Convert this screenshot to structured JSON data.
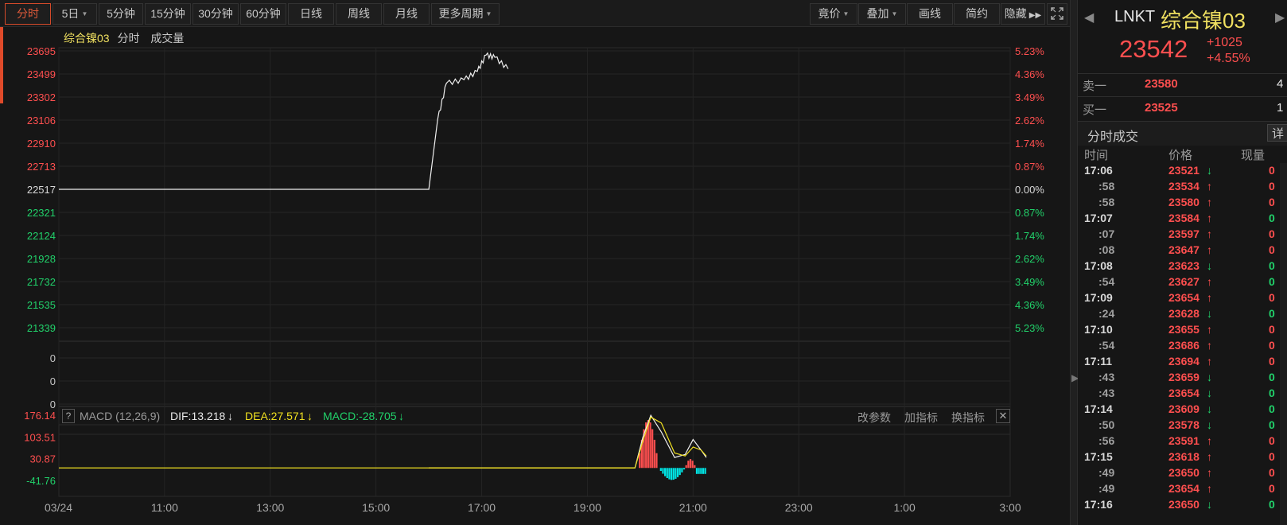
{
  "toolbar": {
    "periods": [
      {
        "label": "分时",
        "active": true
      },
      {
        "label": "5日",
        "dropdown": true
      },
      {
        "label": "5分钟"
      },
      {
        "label": "15分钟"
      },
      {
        "label": "30分钟"
      },
      {
        "label": "60分钟"
      },
      {
        "label": "日线"
      },
      {
        "label": "周线"
      },
      {
        "label": "月线"
      },
      {
        "label": "更多周期",
        "dropdown": true
      }
    ],
    "tools": [
      {
        "label": "竟价",
        "dropdown": true
      },
      {
        "label": "叠加",
        "dropdown": true
      },
      {
        "label": "画线"
      },
      {
        "label": "简约"
      },
      {
        "label": "隐藏"
      }
    ],
    "fullscreen_icon": "fullscreen-icon"
  },
  "legend": {
    "name": "综合镍03",
    "mode": "分时",
    "volume": "成交量"
  },
  "price_axis": {
    "left_labels": [
      "23695",
      "23499",
      "23302",
      "23106",
      "22910",
      "22713",
      "22517",
      "22321",
      "22124",
      "21928",
      "21732",
      "21535",
      "21339"
    ],
    "right_labels": [
      "5.23%",
      "4.36%",
      "3.49%",
      "2.62%",
      "1.74%",
      "0.87%",
      "0.00%",
      "0.87%",
      "1.74%",
      "2.62%",
      "3.49%",
      "4.36%",
      "5.23%"
    ]
  },
  "volume_axis": {
    "labels": [
      "0",
      "0",
      "0"
    ]
  },
  "macd": {
    "help": "?",
    "name": "MACD (12,26,9)",
    "dif": "DIF:13.218",
    "dea": "DEA:27.571",
    "macd_value": "MACD:-28.705",
    "actions": [
      "改参数",
      "加指标",
      "换指标"
    ],
    "axis_labels": [
      "176.14",
      "103.51",
      "30.87",
      "-41.76"
    ]
  },
  "time_axis": [
    "03/24",
    "11:00",
    "13:00",
    "15:00",
    "17:00",
    "19:00",
    "21:00",
    "23:00",
    "1:00",
    "3:00"
  ],
  "colors": {
    "up": "#ff4f4f",
    "down": "#21d16a",
    "accent": "#e05a3a",
    "yellow": "#f0e020",
    "cyan": "#00e5e5"
  },
  "chart_data": [
    {
      "type": "line",
      "series": [],
      "x": [
        "03/24",
        "11:00",
        "13:00",
        "15:00",
        "16:00",
        "16:10",
        "16:20",
        "16:40",
        "16:55",
        "17:05",
        "17:15",
        "17:30"
      ],
      "values": [
        22517,
        22517,
        22517,
        22517,
        22517,
        23110,
        23420,
        23450,
        23520,
        23660,
        23640,
        23542
      ],
      "ylim": [
        21339,
        23695
      ],
      "base": 22517
    },
    {
      "type": "line",
      "series": [
        {
          "x": [
            0,
            3.9,
            4.05,
            4.2,
            4.4,
            4.65,
            4.85,
            5.0,
            5.15,
            5.25
          ],
          "values": [
            0,
            0,
            103,
            176,
            120,
            35,
            45,
            95,
            60,
            35
          ]
        },
        {
          "x": [
            0,
            3.9,
            4.05,
            4.2,
            4.4,
            4.65,
            4.85,
            5.0,
            5.15,
            5.25
          ],
          "values": [
            0,
            0,
            90,
            170,
            150,
            50,
            40,
            70,
            60,
            40
          ]
        }
      ],
      "ylim": [
        -41.76,
        176.14
      ]
    }
  ],
  "quote": {
    "symbol": "LNKT",
    "name": "综合镍03",
    "price": "23542",
    "change": "+1025",
    "change_pct": "+4.55%",
    "ask_label": "卖一",
    "ask_price": "23580",
    "ask_vol": "4",
    "bid_label": "买一",
    "bid_price": "23525",
    "bid_vol": "1"
  },
  "trades": {
    "title": "分时成交",
    "detail": "详",
    "headers": [
      "时间",
      "价格",
      "现量"
    ],
    "rows": [
      {
        "time": "17:06",
        "price": "23521",
        "dir": "down",
        "vol": "0",
        "vol_color": "up"
      },
      {
        "time": ":58",
        "price": "23534",
        "dir": "up",
        "vol": "0",
        "vol_color": "up"
      },
      {
        "time": ":58",
        "price": "23580",
        "dir": "up",
        "vol": "0",
        "vol_color": "up"
      },
      {
        "time": "17:07",
        "price": "23584",
        "dir": "up",
        "vol": "0",
        "vol_color": "down"
      },
      {
        "time": ":07",
        "price": "23597",
        "dir": "up",
        "vol": "0",
        "vol_color": "up"
      },
      {
        "time": ":08",
        "price": "23647",
        "dir": "up",
        "vol": "0",
        "vol_color": "up"
      },
      {
        "time": "17:08",
        "price": "23623",
        "dir": "down",
        "vol": "0",
        "vol_color": "down"
      },
      {
        "time": ":54",
        "price": "23627",
        "dir": "up",
        "vol": "0",
        "vol_color": "down"
      },
      {
        "time": "17:09",
        "price": "23654",
        "dir": "up",
        "vol": "0",
        "vol_color": "up"
      },
      {
        "time": ":24",
        "price": "23628",
        "dir": "down",
        "vol": "0",
        "vol_color": "down"
      },
      {
        "time": "17:10",
        "price": "23655",
        "dir": "up",
        "vol": "0",
        "vol_color": "up"
      },
      {
        "time": ":54",
        "price": "23686",
        "dir": "up",
        "vol": "0",
        "vol_color": "up"
      },
      {
        "time": "17:11",
        "price": "23694",
        "dir": "up",
        "vol": "0",
        "vol_color": "up"
      },
      {
        "time": ":43",
        "price": "23659",
        "dir": "down",
        "vol": "0",
        "vol_color": "down"
      },
      {
        "time": ":43",
        "price": "23654",
        "dir": "down",
        "vol": "0",
        "vol_color": "down"
      },
      {
        "time": "17:14",
        "price": "23609",
        "dir": "down",
        "vol": "0",
        "vol_color": "down"
      },
      {
        "time": ":50",
        "price": "23578",
        "dir": "down",
        "vol": "0",
        "vol_color": "down"
      },
      {
        "time": ":56",
        "price": "23591",
        "dir": "up",
        "vol": "0",
        "vol_color": "up"
      },
      {
        "time": "17:15",
        "price": "23618",
        "dir": "up",
        "vol": "0",
        "vol_color": "up"
      },
      {
        "time": ":49",
        "price": "23650",
        "dir": "up",
        "vol": "0",
        "vol_color": "up"
      },
      {
        "time": ":49",
        "price": "23654",
        "dir": "up",
        "vol": "0",
        "vol_color": "up"
      },
      {
        "time": "17:16",
        "price": "23650",
        "dir": "down",
        "vol": "0",
        "vol_color": "down"
      }
    ]
  }
}
